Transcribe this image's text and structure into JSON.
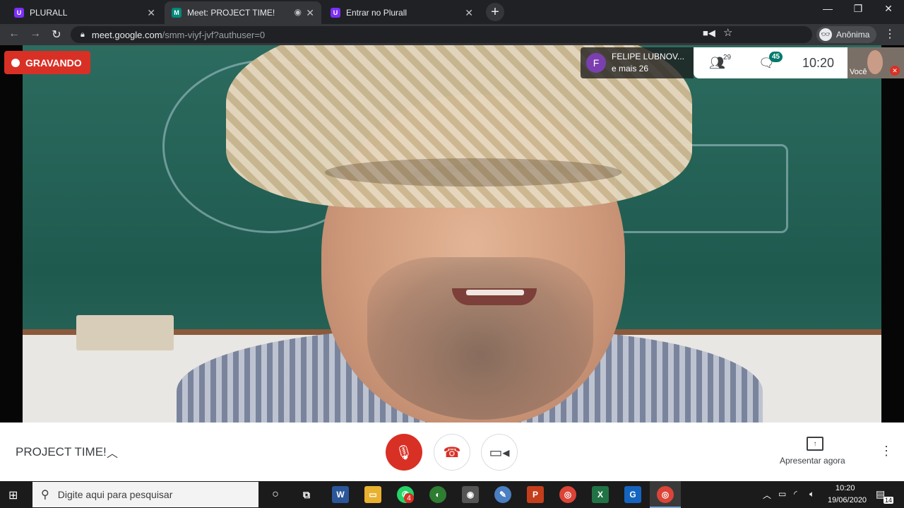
{
  "tabs": [
    {
      "label": "PLURALL",
      "favicon": "U"
    },
    {
      "label": "Meet: PROJECT TIME!",
      "favicon": "M",
      "active": true
    },
    {
      "label": "Entrar no Plurall",
      "favicon": "U"
    }
  ],
  "address": {
    "host": "meet.google.com",
    "path": "/smm-viyf-jvf?authuser=0"
  },
  "profile": {
    "label": "Anônima"
  },
  "recording": {
    "label": "GRAVANDO"
  },
  "presenter": {
    "initial": "F",
    "name": "FELIPE LUBNOV...",
    "others": "e mais 26"
  },
  "top_bar": {
    "participants_count": "29",
    "chat_badge": "45",
    "time": "10:20"
  },
  "self_view": {
    "label": "Você"
  },
  "meeting": {
    "title": "PROJECT TIME!",
    "present_label": "Apresentar agora"
  },
  "taskbar": {
    "search_placeholder": "Digite aqui para pesquisar",
    "whatsapp_badge": "4",
    "time": "10:20",
    "date": "19/06/2020",
    "notifications": "14"
  },
  "colors": {
    "record_red": "#d93025",
    "chat_teal": "#00796b",
    "chrome_dark": "#202124"
  }
}
